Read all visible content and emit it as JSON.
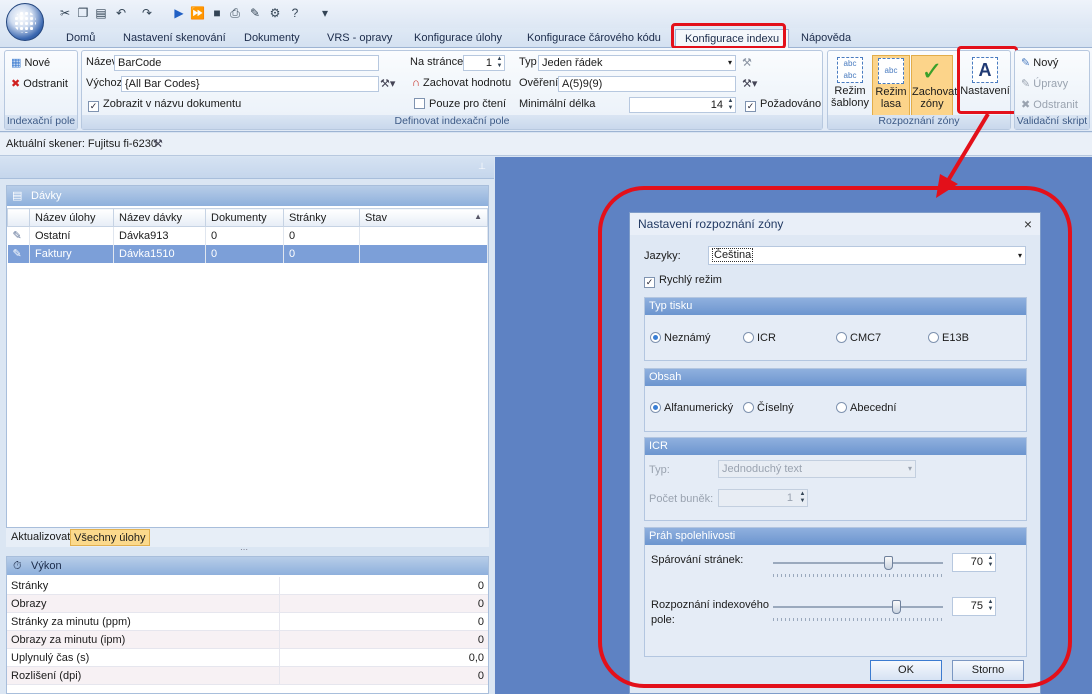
{
  "quick_access": {
    "icons": [
      "cut-icon",
      "copy-icon",
      "paste-icon",
      "undo-icon",
      "redo-icon",
      "play-icon",
      "fast-forward-icon",
      "stop-icon",
      "scanner-icon",
      "edit-icon",
      "settings-icon",
      "help-icon"
    ],
    "customize_label": "▾"
  },
  "tabs": [
    "Domů",
    "Nastavení skenování",
    "Dokumenty",
    "VRS - opravy",
    "Konfigurace úlohy",
    "Konfigurace čárového kódu",
    "Konfigurace indexu",
    "Nápověda"
  ],
  "active_tab": "Konfigurace indexu",
  "ribbon": {
    "index_field_group": {
      "label": "Indexační pole",
      "new": "Nové",
      "remove": "Odstranit"
    },
    "define_group": {
      "label": "Definovat indexační pole",
      "name_label": "Název",
      "name_value": "BarCode",
      "default_label": "Výchozí",
      "default_value": "{All Bar Codes}",
      "show_in_name": "Zobrazit v názvu dokumentu",
      "keep_value": "Zachovat hodnotu",
      "readonly": "Pouze pro čtení",
      "on_page_label": "Na stránce",
      "on_page_value": "1",
      "type_label": "Typ",
      "type_value": "Jeden řádek",
      "validation_label": "Ověření",
      "validation_value": "A(5)9(9)",
      "min_length_label": "Minimální délka",
      "min_length_value": "14",
      "required": "Požadováno"
    },
    "zones_group": {
      "label": "Rozpoznání zóny",
      "template_mode": "Režim šablony",
      "lasso_mode": "Režim lasa",
      "keep_zones": "Zachovat zóny",
      "settings": "Nastavení"
    },
    "validation_group": {
      "label": "Validační skript",
      "new": "Nový",
      "edit": "Úpravy",
      "remove": "Odstranit"
    }
  },
  "scanner_bar": {
    "text": "Aktuální skener: Fujitsu fi-6230"
  },
  "batches": {
    "title": "Dávky",
    "columns": [
      "Název úlohy",
      "Název dávky",
      "Dokumenty",
      "Stránky",
      "Stav"
    ],
    "rows": [
      [
        "Ostatní",
        "Dávka913",
        "0",
        "0",
        ""
      ],
      [
        "Faktury",
        "Dávka1510",
        "0",
        "0",
        ""
      ]
    ],
    "bottom_tabs": [
      "Aktualizovat",
      "Všechny úlohy"
    ]
  },
  "performance": {
    "title": "Výkon",
    "rows": [
      {
        "k": "Stránky",
        "v": "0"
      },
      {
        "k": "Obrazy",
        "v": "0"
      },
      {
        "k": "Stránky za minutu (ppm)",
        "v": "0"
      },
      {
        "k": "Obrazy za minutu (ipm)",
        "v": "0"
      },
      {
        "k": "Uplynulý čas (s)",
        "v": "0,0"
      },
      {
        "k": "Rozlišení (dpi)",
        "v": "0"
      }
    ]
  },
  "dialog": {
    "title": "Nastavení rozpoznání zóny",
    "close": "×",
    "languages_label": "Jazyky:",
    "languages_value": "Čeština",
    "fast_mode": "Rychlý režim",
    "print_type": {
      "title": "Typ tisku",
      "options": [
        "Neznámý",
        "ICR",
        "CMC7",
        "E13B"
      ],
      "selected": 0
    },
    "content": {
      "title": "Obsah",
      "options": [
        "Alfanumerický",
        "Číselný",
        "Abecední"
      ],
      "selected": 0
    },
    "icr": {
      "title": "ICR",
      "type_label": "Typ:",
      "type_value": "Jednoduchý text",
      "cells_label": "Počet buněk:",
      "cells_value": "1"
    },
    "confidence": {
      "title": "Práh spolehlivosti",
      "page_pairing_label": "Spárování stránek:",
      "page_pairing_value": "70",
      "field_recognition_label": "Rozpoznání indexového pole:",
      "field_recognition_value": "75"
    },
    "ok": "OK",
    "cancel": "Storno"
  },
  "colors": {
    "highlight_red": "#e3101a",
    "selection_blue": "#7c9fd8",
    "workspace_blue": "#5e82c3"
  }
}
